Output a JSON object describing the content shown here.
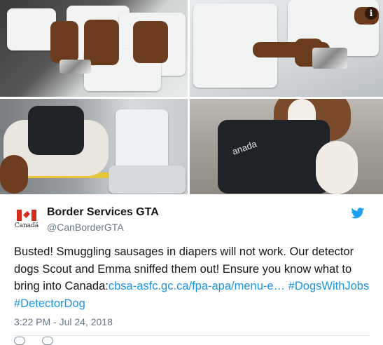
{
  "photos": {
    "vest_text_overlay": "anada"
  },
  "account": {
    "name": "Border Services GTA",
    "handle": "@CanBorderGTA",
    "logo_wordmark": "Canadä"
  },
  "tweet": {
    "text_part1": "Busted! Smuggling sausages in diapers will not work. Our detector dogs Scout and Emma sniffed them out! Ensure you know what to bring into Canada:",
    "link_text": "cbsa-asfc.gc.ca/fpa-apa/menu-e…",
    "hashtag1": "#DogsWithJobs",
    "hashtag2": "#DetectorDog",
    "timestamp": "3:22 PM - Jul 24, 2018"
  },
  "colors": {
    "link_blue": "#1b95e0",
    "twitter_blue": "#1da1f2",
    "canada_red": "#d52b1e"
  },
  "icons": [
    "info-icon",
    "twitter-bird-icon",
    "reply-icon",
    "retweet-icon"
  ]
}
